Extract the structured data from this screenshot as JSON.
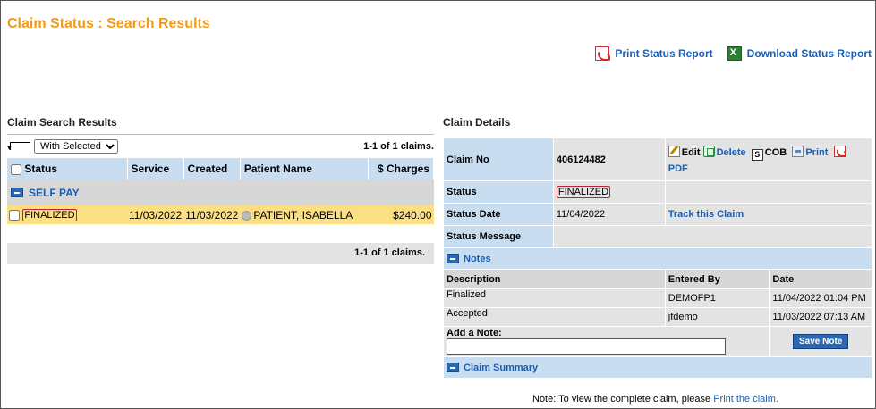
{
  "page": {
    "title": "Claim Status : Search Results",
    "print_status_report": "Print Status Report",
    "download_status_report": "Download Status Report"
  },
  "results": {
    "section_title": "Claim Search Results",
    "bulk_select": "With Selected",
    "count_top": "1-1 of 1 claims.",
    "count_bottom": "1-1 of 1 claims.",
    "columns": [
      "Status",
      "Service",
      "Created",
      "Patient Name",
      "$ Charges"
    ],
    "group_label": "SELF PAY",
    "row": {
      "status": "FINALIZED",
      "service": "11/03/2022",
      "created": "11/03/2022",
      "patient": "PATIENT, ISABELLA",
      "charges": "$240.00"
    }
  },
  "details": {
    "section_title": "Claim Details",
    "claim_no_label": "Claim No",
    "claim_no": "406124482",
    "actions": {
      "edit": "Edit",
      "delete": "Delete",
      "cob": "COB",
      "print": "Print",
      "pdf": "PDF"
    },
    "status_label": "Status",
    "status": "FINALIZED",
    "status_date_label": "Status Date",
    "status_date": "11/04/2022",
    "track_claim": "Track this Claim",
    "status_message_label": "Status Message",
    "notes_label": "Notes",
    "notes_columns": [
      "Description",
      "Entered By",
      "Date"
    ],
    "notes": [
      {
        "description": "Finalized",
        "entered_by": "DEMOFP1",
        "date": "11/04/2022 01:04 PM"
      },
      {
        "description": "Accepted",
        "entered_by": "jfdemo",
        "date": "11/03/2022 07:13 AM"
      }
    ],
    "add_note_label": "Add a Note:",
    "add_note_value": "",
    "save_note": "Save Note",
    "claim_summary_label": "Claim Summary",
    "footer_note": "Note:  To view the complete claim, please",
    "footer_link": "Print the claim."
  },
  "colors": {
    "title_orange": "#f29a17",
    "link_blue": "#1a5fb4",
    "header_blue": "#c9ddf1",
    "selected_row": "#fcdf85"
  }
}
